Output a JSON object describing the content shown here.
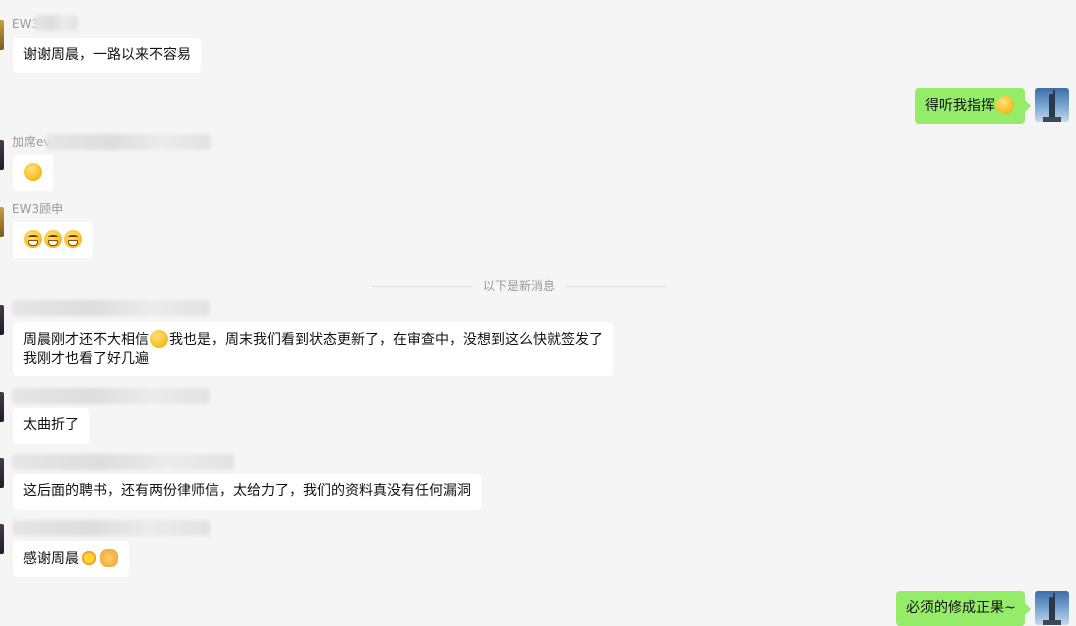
{
  "messages": [
    {
      "id": "m1",
      "sender": "EW3",
      "text": "谢谢周晨，一路以来不容易"
    },
    {
      "id": "m2",
      "text": "得听我指挥"
    },
    {
      "id": "m3",
      "sender": "加席ev"
    },
    {
      "id": "m4",
      "sender": "EW3顾申"
    },
    {
      "id": "m5",
      "line1": "周晨刚才还不大相信",
      "line1b": "我也是，周末我们看到状态更新了，在审查中，没想到这么快就签发了",
      "line2": "我刚才也看了好几遍"
    },
    {
      "id": "m6",
      "text": "太曲折了"
    },
    {
      "id": "m7",
      "text": "这后面的聘书，还有两份律师信，太给力了，我们的资料真没有任何漏洞"
    },
    {
      "id": "m8",
      "text": "感谢周晨"
    },
    {
      "id": "m9",
      "text": "必须的修成正果~"
    }
  ],
  "divider": {
    "label": "以下是新消息"
  },
  "icons": {
    "emoji_thinking": "thinking-face-emoji",
    "emoji_crying_laugh": "rolling-laugh-emoji",
    "emoji_grin": "grinning-face-emoji",
    "emoji_laugh": "laughing-face-emoji",
    "emoji_sun": "sun-emoji",
    "emoji_handshake": "handshake-emoji"
  },
  "colors": {
    "background": "#f5f5f5",
    "incoming_bubble": "#ffffff",
    "outgoing_bubble": "#95ec69",
    "sender_text": "#9a9a9a"
  }
}
